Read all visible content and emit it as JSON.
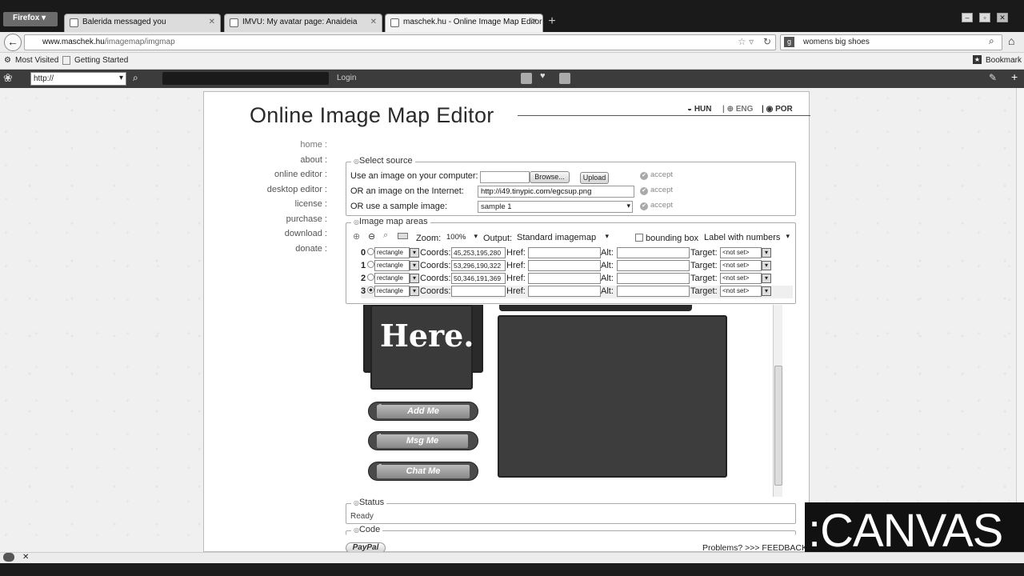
{
  "browser": {
    "menu_label": "Firefox",
    "tabs": [
      {
        "label": "Balerida messaged you"
      },
      {
        "label": "IMVU: My avatar page: Anaideia"
      },
      {
        "label": "maschek.hu - Online Image Map Editor"
      }
    ],
    "url_domain": "www.maschek.hu",
    "url_path": "/imagemap/imgmap",
    "search_value": "womens big shoes",
    "bookmarks": [
      "Most Visited",
      "Getting Started"
    ],
    "bookmarks_menu": "Bookmark",
    "toolbar_input": "http://",
    "toolbar_login": "Login"
  },
  "site": {
    "title": "Online Image Map Editor",
    "languages": [
      {
        "code": "HUN"
      },
      {
        "code": "ENG"
      },
      {
        "code": "POR"
      }
    ],
    "menu": [
      "home :",
      "about :",
      "online editor :",
      "desktop editor :",
      "license :",
      "purchase :",
      "download :",
      "donate :"
    ]
  },
  "source": {
    "legend": "Select source",
    "computer_label": "Use an image on your computer:",
    "browse_label": "Browse...",
    "upload_label": "Upload",
    "internet_label": "OR an image on the Internet:",
    "internet_value": "http://i49.tinypic.com/egcsup.png",
    "sample_label": "OR use a sample image:",
    "sample_value": "sample 1",
    "accept_label": "accept"
  },
  "areas": {
    "legend": "Image map areas",
    "zoom_label": "Zoom:",
    "zoom_value": "100%",
    "output_label": "Output:",
    "output_value": "Standard imagemap",
    "bounding_label": "bounding box",
    "label_mode": "Label with numbers",
    "coords_label": "Coords:",
    "href_label": "Href:",
    "alt_label": "Alt:",
    "target_label": "Target:",
    "rows": [
      {
        "index": "0",
        "shape": "rectangle",
        "coords": "45,253,195,280",
        "target": "<not set>"
      },
      {
        "index": "1",
        "shape": "rectangle",
        "coords": "53,296,190,322",
        "target": "<not set>"
      },
      {
        "index": "2",
        "shape": "rectangle",
        "coords": "50,346,191,369",
        "target": "<not set>"
      },
      {
        "index": "3",
        "shape": "rectangle",
        "coords": "",
        "target": "<not set>"
      }
    ]
  },
  "preview": {
    "here_text": "Here.",
    "buttons": [
      {
        "num": "0",
        "label": "Add Me"
      },
      {
        "num": "1",
        "label": "Msg Me"
      },
      {
        "num": "2",
        "label": "Chat Me"
      }
    ]
  },
  "status": {
    "legend": "Status",
    "text": "Ready"
  },
  "code": {
    "legend": "Code"
  },
  "footer": {
    "paypal": "PayPal",
    "problems": "Problems? >>> FEEDBACK"
  },
  "overlay": {
    "logo_text": ":CANVAS"
  }
}
